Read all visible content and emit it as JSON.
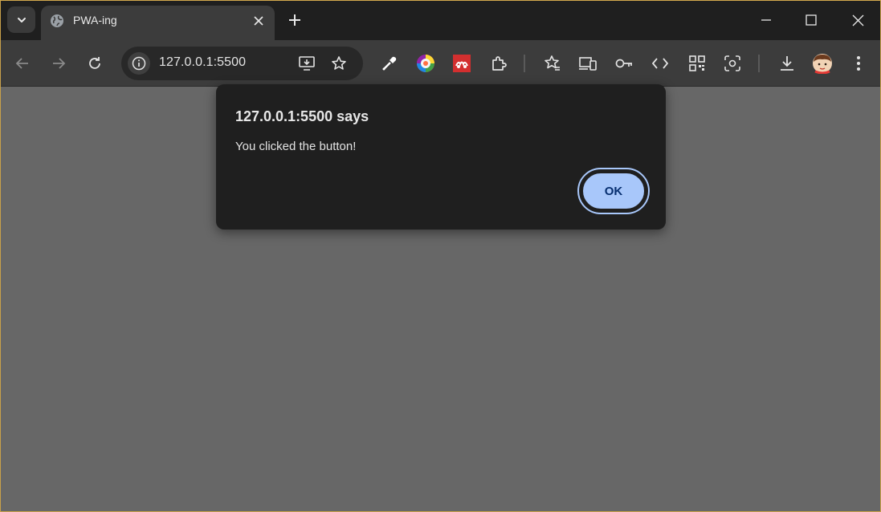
{
  "tab": {
    "title": "PWA-ing",
    "favicon": "globe-icon"
  },
  "omnibox": {
    "url": "127.0.0.1:5500"
  },
  "toolbar": {
    "icons": [
      "back-icon",
      "forward-icon",
      "reload-icon",
      "site-info-icon",
      "install-app-icon",
      "bookmark-star-icon",
      "eyedropper-icon",
      "color-wheel-icon",
      "mendeley-icon",
      "extensions-icon",
      "reading-list-icon",
      "device-toolbar-icon",
      "password-key-icon",
      "code-icon",
      "qr-code-icon",
      "lens-icon",
      "download-icon",
      "profile-avatar",
      "menu-icon"
    ]
  },
  "dialog": {
    "heading": "127.0.0.1:5500 says",
    "message": "You clicked the button!",
    "ok_label": "OK"
  },
  "colors": {
    "page_bg": "#676767",
    "dialog_bg": "#1f1f1f",
    "accent": "#a8c7fa",
    "accent_text": "#062e6f"
  }
}
